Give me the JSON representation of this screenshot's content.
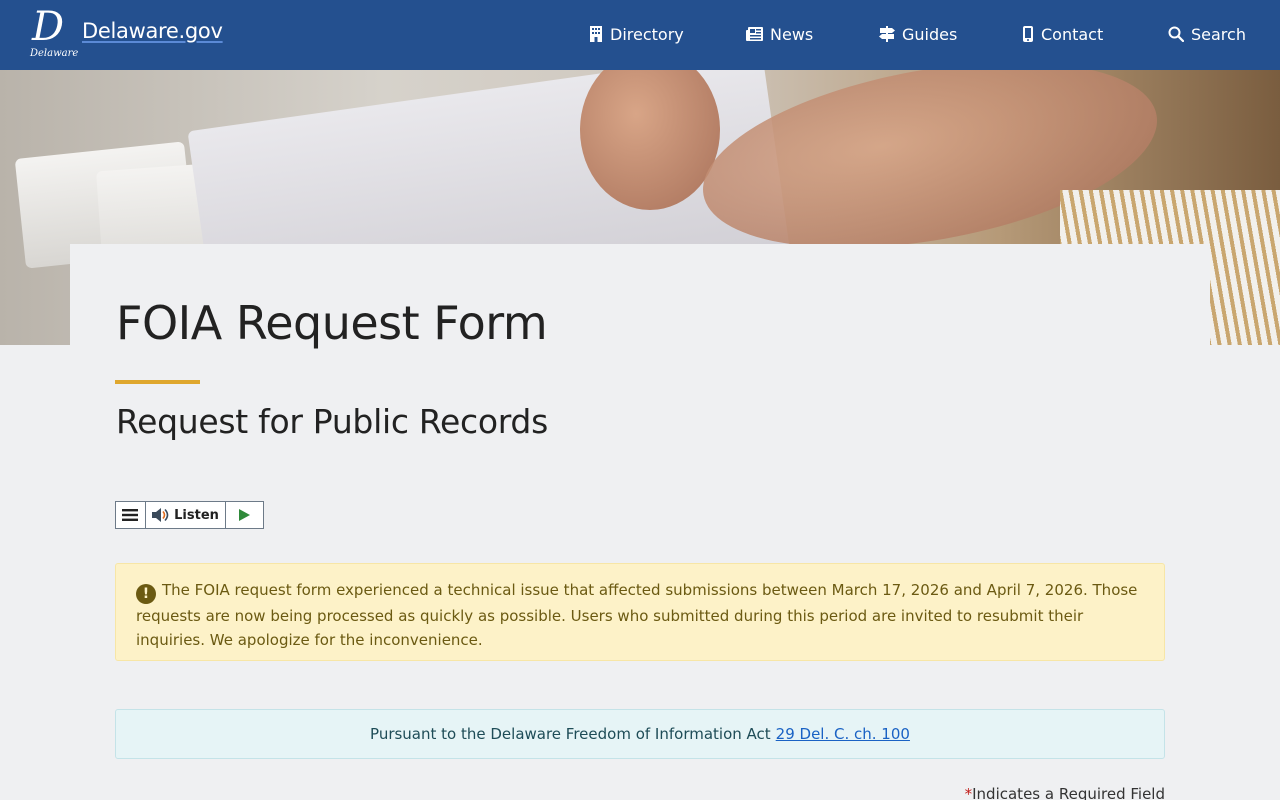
{
  "header": {
    "logo_letter": "D",
    "logo_subtext": "Delaware",
    "site_name": "Delaware.gov",
    "nav": [
      {
        "label": "Directory",
        "icon": "building-icon"
      },
      {
        "label": "News",
        "icon": "newspaper-icon"
      },
      {
        "label": "Guides",
        "icon": "signpost-icon"
      },
      {
        "label": "Contact",
        "icon": "phone-icon"
      },
      {
        "label": "Search",
        "icon": "search-icon"
      }
    ]
  },
  "page": {
    "title": "FOIA Request Form",
    "subtitle": "Request for Public Records"
  },
  "listen_widget": {
    "label": "Listen"
  },
  "alert": {
    "text": "The FOIA request form experienced a technical issue that affected submissions between March 17, 2026 and April 7, 2026. Those requests are now being processed as quickly as possible. Users who submitted during this period are invited to resubmit their inquiries. We apologize for the inconvenience."
  },
  "info": {
    "text": "Pursuant to the Delaware Freedom of Information Act",
    "link_text": "29 Del. C. ch. 100"
  },
  "form": {
    "required_marker": "*",
    "required_note": "Indicates a Required Field"
  },
  "colors": {
    "header_bg": "#24508f",
    "accent_rule": "#dfa72e",
    "alert_bg": "#fdf2c8",
    "info_bg": "#e6f4f6",
    "link": "#1a62c4"
  }
}
